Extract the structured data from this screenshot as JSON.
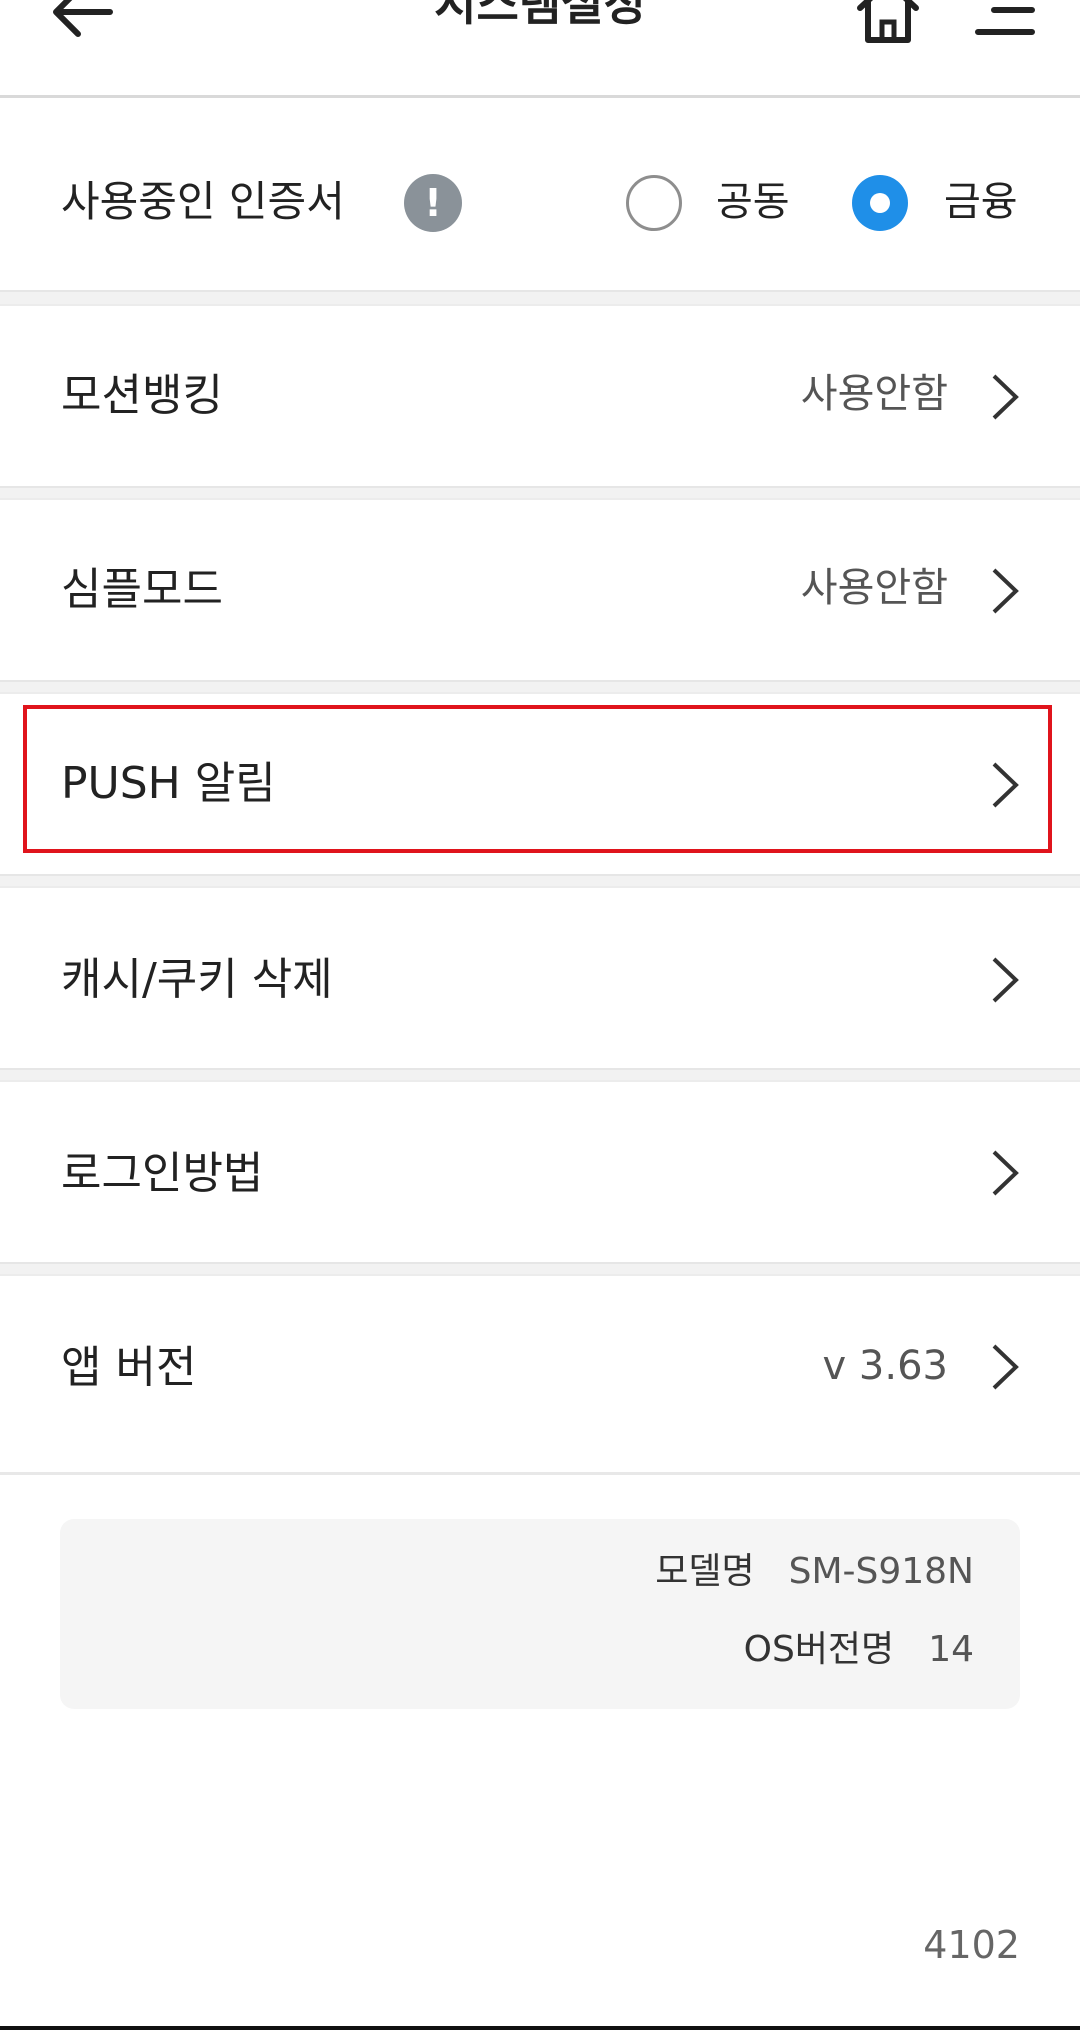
{
  "header": {
    "title": "시스템설정",
    "back_icon": "arrow-left-icon",
    "home_icon": "home-icon",
    "menu_icon": "menu-icon"
  },
  "certificate": {
    "label": "사용중인 인증서",
    "info_icon_text": "!",
    "options": [
      {
        "label": "공동",
        "selected": false
      },
      {
        "label": "금융",
        "selected": true
      }
    ],
    "accent_color": "#1f8fe8"
  },
  "settings": [
    {
      "label": "모션뱅킹",
      "value": "사용안함"
    },
    {
      "label": "심플모드",
      "value": "사용안함"
    },
    {
      "label": "PUSH 알림",
      "value": "",
      "highlighted": true
    },
    {
      "label": "캐시/쿠키 삭제",
      "value": ""
    },
    {
      "label": "로그인방법",
      "value": ""
    },
    {
      "label": "앱 버전",
      "value": "v 3.63"
    }
  ],
  "device": {
    "model_label": "모델명",
    "model_value": "SM-S918N",
    "os_label": "OS버전명",
    "os_value": "14"
  },
  "footer": {
    "build_number": "4102"
  }
}
